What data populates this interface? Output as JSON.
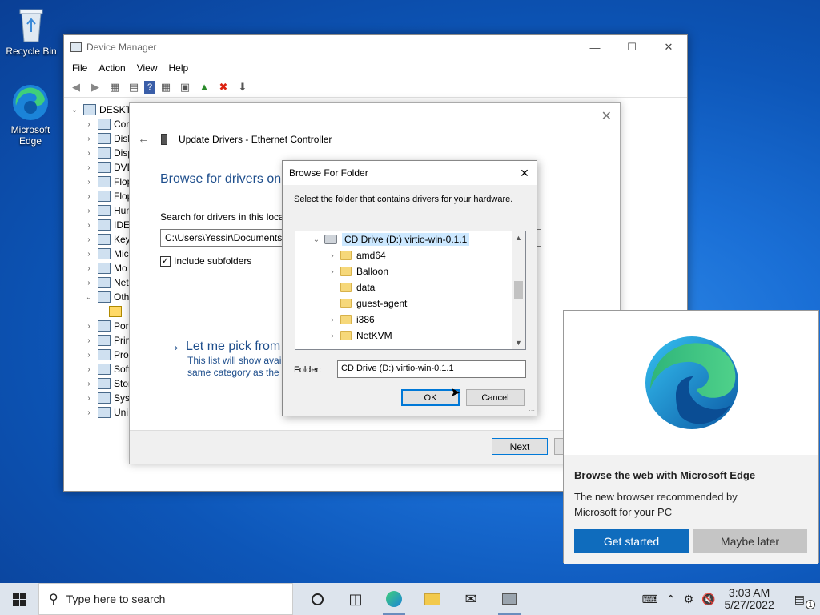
{
  "desktop": {
    "recycle_bin": "Recycle Bin",
    "edge_line1": "Microsoft",
    "edge_line2": "Edge"
  },
  "device_manager": {
    "title": "Device Manager",
    "menu": [
      "File",
      "Action",
      "View",
      "Help"
    ],
    "root": "DESKTO",
    "tree": [
      "Cor",
      "Disk",
      "Disp",
      "DVD",
      "Flop",
      "Flop",
      "Hum",
      "IDE",
      "Key",
      "Mic",
      "Mo",
      "Net",
      "Oth",
      "",
      "Por",
      "Prin",
      "Pro",
      "Soft",
      "Stor",
      "Syst",
      "Uni"
    ]
  },
  "wizard": {
    "title": "Update Drivers - Ethernet Controller",
    "heading": "Browse for drivers on",
    "search_label": "Search for drivers in this loca",
    "path": "C:\\Users\\Yessir\\Documents",
    "include_subfolders": "Include subfolders",
    "pick_link": "Let me pick from",
    "pick_desc1": "This list will show avail",
    "pick_desc2": "same category as the d",
    "next": "Next"
  },
  "browse_folder": {
    "title": "Browse For Folder",
    "instruction": "Select the folder that contains drivers for your hardware.",
    "drive": "CD Drive (D:) virtio-win-0.1.1",
    "folders": [
      "amd64",
      "Balloon",
      "data",
      "guest-agent",
      "i386",
      "NetKVM"
    ],
    "folder_label": "Folder:",
    "folder_value": "CD Drive (D:) virtio-win-0.1.1",
    "ok": "OK",
    "cancel": "Cancel"
  },
  "edge_popup": {
    "title": "Browse the web with Microsoft Edge",
    "body_line1": "The new browser recommended by",
    "body_line2": "Microsoft for your PC",
    "get_started": "Get started",
    "maybe_later": "Maybe later"
  },
  "taskbar": {
    "search_placeholder": "Type here to search",
    "time": "3:03 AM",
    "date": "5/27/2022",
    "notification_count": "1"
  }
}
